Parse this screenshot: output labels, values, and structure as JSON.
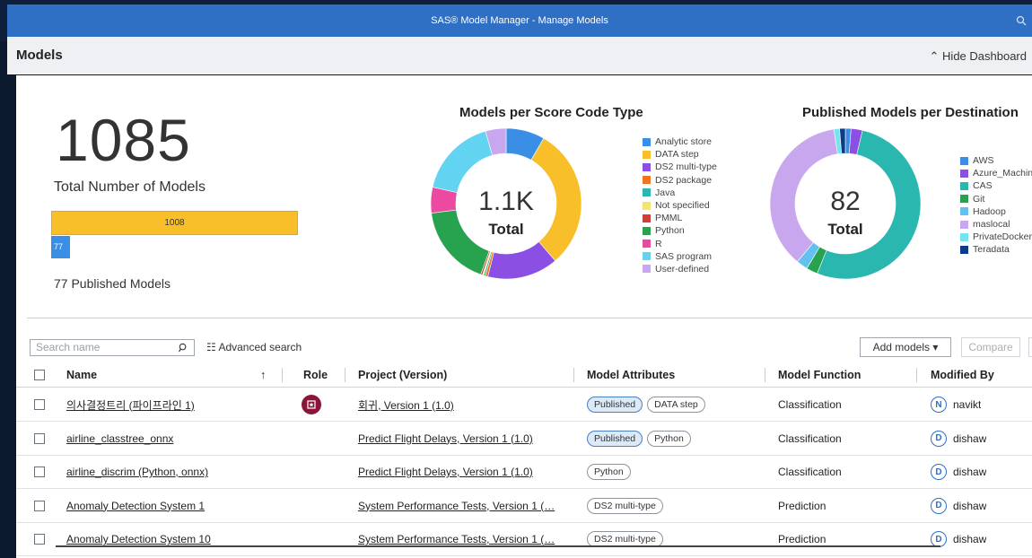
{
  "window": {
    "title": "SAS® Model Manager - Manage Models"
  },
  "header": {
    "page_title": "Models",
    "hide_dashboard": "Hide Dashboard"
  },
  "dashboard": {
    "total_models": "1085",
    "total_label": "Total Number of Models",
    "bar_total_label": "1008",
    "bar_published_label": "77",
    "published_label": "77 Published Models",
    "colors": {
      "bar_total": "#f8bf2a",
      "bar_published": "#3a8ee6"
    }
  },
  "score_code_chart": {
    "title": "Models per Score Code Type",
    "center_value": "1.1K",
    "center_label": "Total",
    "legend": [
      {
        "label": "Analytic store",
        "color": "#3a8ee6"
      },
      {
        "label": "DATA step",
        "color": "#f8bf2a"
      },
      {
        "label": "DS2 multi-type",
        "color": "#8b4fe3"
      },
      {
        "label": "DS2 package",
        "color": "#f07320"
      },
      {
        "label": "Java",
        "color": "#2ab7b0"
      },
      {
        "label": "Not specified",
        "color": "#f4e66b"
      },
      {
        "label": "PMML",
        "color": "#d63b3b"
      },
      {
        "label": "Python",
        "color": "#27a34f"
      },
      {
        "label": "R",
        "color": "#ec4aa0"
      },
      {
        "label": "SAS program",
        "color": "#63d3f2"
      },
      {
        "label": "User-defined",
        "color": "#c9a7ee"
      }
    ]
  },
  "destination_chart": {
    "title": "Published Models per Destination",
    "center_value": "82",
    "center_label": "Total",
    "legend": [
      {
        "label": "AWS",
        "color": "#3a8ee6"
      },
      {
        "label": "Azure_Machin",
        "color": "#8b4fe3"
      },
      {
        "label": "CAS",
        "color": "#2ab7b0"
      },
      {
        "label": "Git",
        "color": "#27a34f"
      },
      {
        "label": "Hadoop",
        "color": "#63c1ef"
      },
      {
        "label": "maslocal",
        "color": "#c9a7ee"
      },
      {
        "label": "PrivateDocker",
        "color": "#74e5ef"
      },
      {
        "label": "Teradata",
        "color": "#0d3b8c"
      }
    ]
  },
  "chart_data": [
    {
      "type": "pie",
      "title": "Models per Score Code Type",
      "categories": [
        "Analytic store",
        "DATA step",
        "DS2 multi-type",
        "DS2 package",
        "Java",
        "Not specified",
        "PMML",
        "Python",
        "R",
        "SAS program",
        "User-defined"
      ],
      "values": [
        90,
        330,
        165,
        6,
        4,
        3,
        4,
        190,
        60,
        185,
        48
      ],
      "center_value": "1.1K",
      "center_label": "Total"
    },
    {
      "type": "pie",
      "title": "Published Models per Destination",
      "categories": [
        "AWS",
        "Azure_Machin",
        "CAS",
        "Git",
        "Hadoop",
        "maslocal",
        "PrivateDocker",
        "Teradata"
      ],
      "values": [
        1,
        2,
        43,
        2,
        2,
        30,
        1,
        1
      ],
      "center_value": "82",
      "center_label": "Total"
    }
  ],
  "toolbar": {
    "search_placeholder": "Search name",
    "advanced_search": "Advanced search",
    "add_models": "Add models ▾",
    "compare": "Compare"
  },
  "table": {
    "columns": {
      "name": "Name",
      "sort": "↑",
      "role": "Role",
      "project": "Project (Version)",
      "attributes": "Model Attributes",
      "function": "Model Function",
      "modified_by": "Modified By"
    },
    "rows": [
      {
        "name": "의사결정트리 (파이프라인 1)",
        "role_icon": "champion-icon",
        "project": "회귀, Version 1 (1.0)",
        "attributes": [
          "Published",
          "DATA step"
        ],
        "function": "Classification",
        "initial": "N",
        "modified_by": "navikt"
      },
      {
        "name": "airline_classtree_onnx",
        "role_icon": "",
        "project": "Predict Flight Delays, Version 1 (1.0)",
        "attributes": [
          "Published",
          "Python"
        ],
        "function": "Classification",
        "initial": "D",
        "modified_by": "dishaw"
      },
      {
        "name": "airline_discrim (Python, onnx)",
        "role_icon": "",
        "project": "Predict Flight Delays, Version 1 (1.0)",
        "attributes": [
          "Python"
        ],
        "function": "Classification",
        "initial": "D",
        "modified_by": "dishaw"
      },
      {
        "name": "Anomaly Detection System 1",
        "role_icon": "",
        "project": "System Performance Tests, Version 1 (…",
        "attributes": [
          "DS2 multi-type"
        ],
        "function": "Prediction",
        "initial": "D",
        "modified_by": "dishaw"
      },
      {
        "name": "Anomaly Detection System 10",
        "role_icon": "",
        "project": "System Performance Tests, Version 1 (…",
        "attributes": [
          "DS2 multi-type"
        ],
        "function": "Prediction",
        "initial": "D",
        "modified_by": "dishaw"
      }
    ]
  }
}
